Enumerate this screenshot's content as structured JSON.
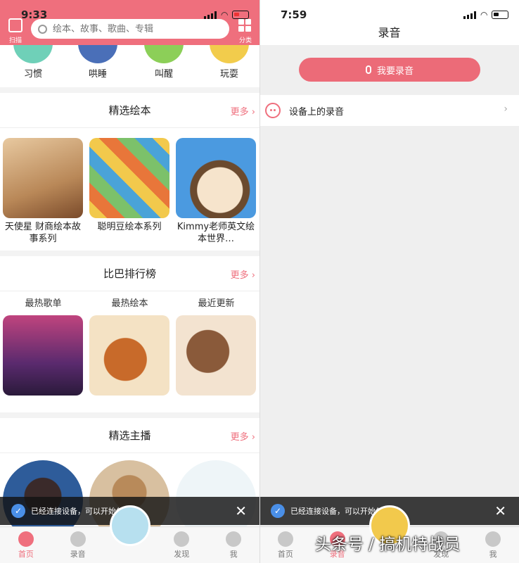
{
  "left": {
    "status": {
      "time": "9:33"
    },
    "header": {
      "scan_label": "扫描",
      "search_placeholder": "绘本、故事、歌曲、专辑",
      "category_label": "分类"
    },
    "categories": [
      {
        "label": "习惯",
        "color": "#6fd0b8"
      },
      {
        "label": "哄睡",
        "color": "#4a6fb8"
      },
      {
        "label": "叫醒",
        "color": "#8ccf58"
      },
      {
        "label": "玩耍",
        "color": "#f2cc4c"
      }
    ],
    "featured_books": {
      "title": "精选绘本",
      "more": "更多",
      "items": [
        {
          "title": "天使星 财商绘本故事系列",
          "color": "#d9b88c"
        },
        {
          "title": "聪明豆绘本系列",
          "color": "#8cc27a"
        },
        {
          "title": "Kimmy老师英文绘本世界…",
          "color": "#5aa4e0"
        }
      ]
    },
    "rankings": {
      "title": "比巴排行榜",
      "more": "更多",
      "tabs": [
        "最热歌单",
        "最热绘本",
        "最近更新"
      ],
      "colors": [
        "#b44c8c",
        "#e8a84c",
        "#e8d8c4"
      ]
    },
    "anchors": {
      "title": "精选主播",
      "more": "更多",
      "colors": [
        "#3a6fb0",
        "#c8a880",
        "#e8f0f4"
      ]
    },
    "toast": {
      "text": "已经连接设备，可以开始使用了"
    },
    "tabbar": [
      {
        "label": "首页"
      },
      {
        "label": "录音"
      },
      {
        "label": ""
      },
      {
        "label": "发现"
      },
      {
        "label": "我"
      }
    ]
  },
  "right": {
    "status": {
      "time": "7:59"
    },
    "title": "录音",
    "record_button": "我要录音",
    "device_recordings": "设备上的录音",
    "toast": {
      "text": "已经连接设备，可以开始使用了"
    },
    "tabbar": [
      {
        "label": "首页"
      },
      {
        "label": "录音"
      },
      {
        "label": ""
      },
      {
        "label": "发现"
      },
      {
        "label": "我"
      }
    ]
  },
  "watermark": "头条号 / 搞机特战员",
  "accent_color": "#ef6f7d"
}
